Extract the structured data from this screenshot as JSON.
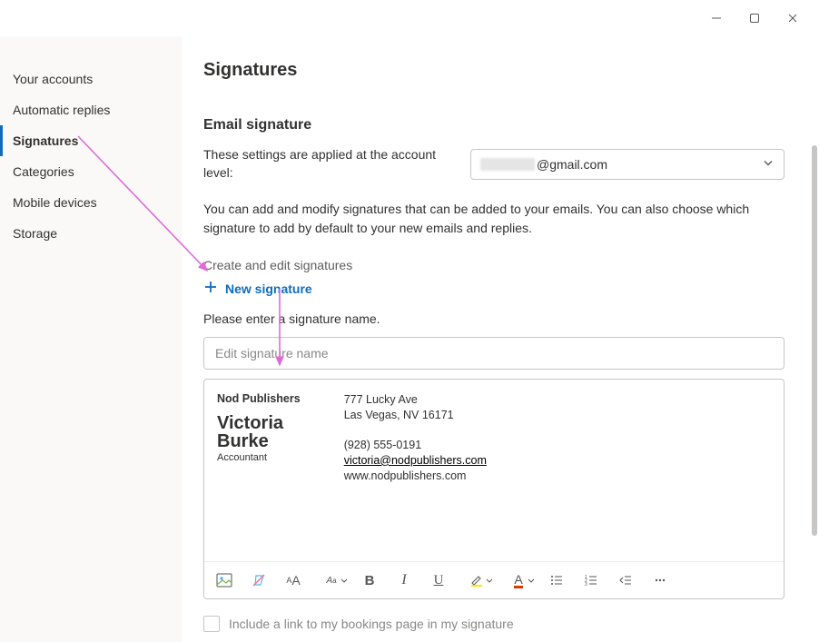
{
  "sidebar": {
    "items": [
      {
        "label": "Your accounts"
      },
      {
        "label": "Automatic replies"
      },
      {
        "label": "Signatures",
        "selected": true
      },
      {
        "label": "Categories"
      },
      {
        "label": "Mobile devices"
      },
      {
        "label": "Storage"
      }
    ]
  },
  "page": {
    "title": "Signatures",
    "section_title": "Email signature",
    "account_label": "These settings are applied at the account level:",
    "account_value_suffix": "@gmail.com",
    "description": "You can add and modify signatures that can be added to your emails. You can also choose which signature to add by default to your new emails and replies.",
    "create_edit_label": "Create and edit signatures",
    "new_signature_label": "New signature",
    "prompt": "Please enter a signature name.",
    "name_placeholder": "Edit signature name",
    "bookings_label": "Include a link to my bookings page in my signature"
  },
  "signature_preview": {
    "company": "Nod Publishers",
    "person_first": "Victoria",
    "person_last": "Burke",
    "role": "Accountant",
    "address_line1": "777 Lucky Ave",
    "address_line2": "Las Vegas, NV 16171",
    "phone": "(928) 555-0191",
    "email": "victoria@nodpublishers.com",
    "website": "www.nodpublishers.com"
  },
  "toolbar_icons": [
    "image-icon",
    "clear-format-icon",
    "font-size-icon",
    "font-size-dropdown-icon",
    "bold-icon",
    "italic-icon",
    "underline-icon",
    "highlight-icon",
    "font-color-icon",
    "bullet-list-icon",
    "number-list-icon",
    "outdent-icon",
    "more-icon"
  ]
}
